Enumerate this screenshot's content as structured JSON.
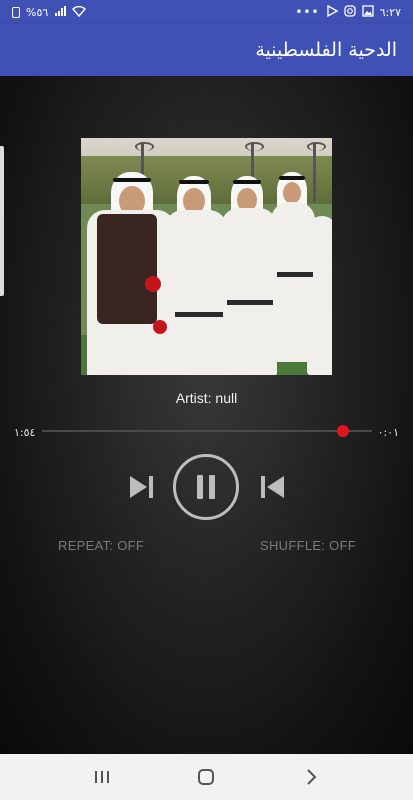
{
  "status_bar": {
    "time": "٦:٢٧",
    "battery": "%٥٦",
    "dots": "•••"
  },
  "app_bar": {
    "title": "الدحية الفلسطينية"
  },
  "now_playing": {
    "artist": "Artist: null"
  },
  "seek": {
    "elapsed": "٠:٠١",
    "duration": "١:٥٤",
    "progress": 0.99
  },
  "controls": {
    "repeat": "REPEAT: OFF",
    "shuffle": "SHUFFLE: OFF"
  },
  "colors": {
    "primary": "#3f51b5",
    "seek_thumb": "#e0161c",
    "control": "#bdbdbd"
  },
  "icons": {
    "next": "skip-next-icon",
    "play_pause": "pause-icon",
    "prev": "skip-previous-icon",
    "recents": "recents-icon",
    "home": "home-icon",
    "back": "back-icon"
  }
}
